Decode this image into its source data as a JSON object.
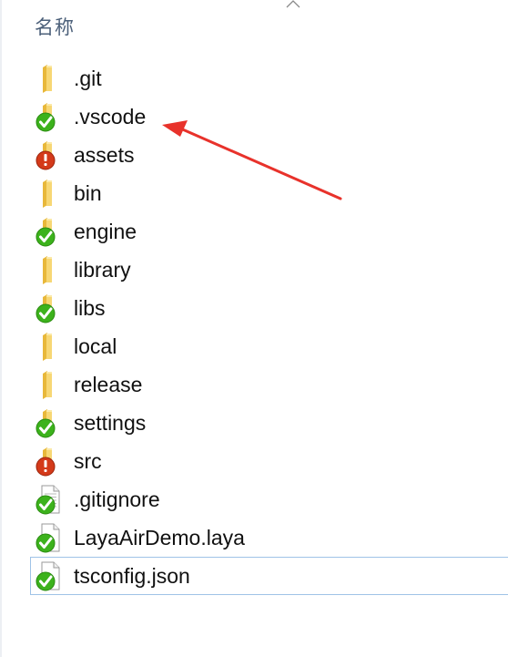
{
  "header": {
    "column_name": "名称",
    "sort_icon": "chevron-up-icon"
  },
  "colors": {
    "folder": "#f7d774",
    "folder_dark": "#e8b83a",
    "ok_badge": "#3cb21c",
    "error_badge": "#d43a1a",
    "selection_border": "#9fc3e7",
    "annotation_arrow": "#e8322b"
  },
  "files": [
    {
      "name": ".git",
      "type": "folder",
      "status": "none"
    },
    {
      "name": ".vscode",
      "type": "folder",
      "status": "ok"
    },
    {
      "name": "assets",
      "type": "folder",
      "status": "error"
    },
    {
      "name": "bin",
      "type": "folder",
      "status": "none"
    },
    {
      "name": "engine",
      "type": "folder",
      "status": "ok"
    },
    {
      "name": "library",
      "type": "folder",
      "status": "none"
    },
    {
      "name": "libs",
      "type": "folder",
      "status": "ok"
    },
    {
      "name": "local",
      "type": "folder",
      "status": "none"
    },
    {
      "name": "release",
      "type": "folder",
      "status": "none"
    },
    {
      "name": "settings",
      "type": "folder",
      "status": "ok"
    },
    {
      "name": "src",
      "type": "folder",
      "status": "error"
    },
    {
      "name": ".gitignore",
      "type": "text-file",
      "status": "ok"
    },
    {
      "name": "LayaAirDemo.laya",
      "type": "file",
      "status": "ok"
    },
    {
      "name": "tsconfig.json",
      "type": "file",
      "status": "ok",
      "selected": true
    }
  ],
  "annotation": {
    "type": "arrow",
    "points_to": ".vscode"
  }
}
